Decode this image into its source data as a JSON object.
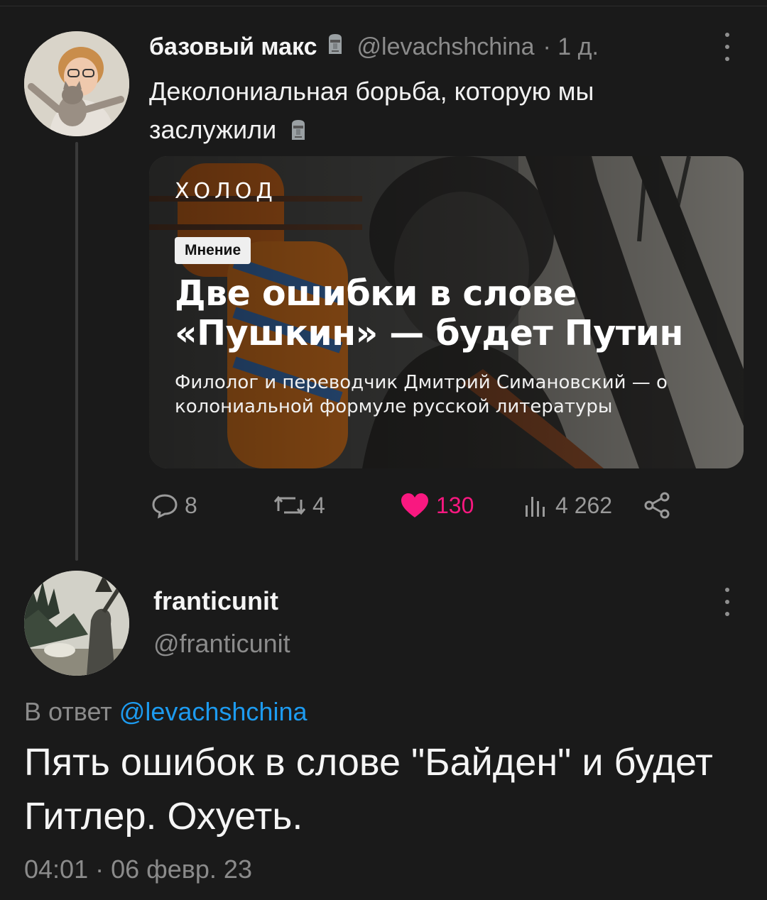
{
  "parent_tweet": {
    "author_name": "базовый макс",
    "name_emoji_icon": "moai-icon",
    "handle": "@levachshchina",
    "time": "· 1 д.",
    "text": "Деколониальная борьба, которую мы заслужили",
    "card": {
      "brand": "ХОЛОД",
      "tag": "Мнение",
      "headline": "Две ошибки в слове «Пушкин» — будет Путин",
      "subline": "Филолог и переводчик Дмитрий Симановский — о колониальной формуле русской литературы"
    },
    "actions": {
      "replies": "8",
      "retweets": "4",
      "likes": "130",
      "views": "4 262",
      "like_color": "#f91880"
    }
  },
  "reply_tweet": {
    "author_name": "franticunit",
    "handle": "@franticunit",
    "reply_to_prefix": "В ответ",
    "reply_to_handle": "@levachshchina",
    "text": "Пять ошибок в слове \"Байден\" и будет Гитлер. Охуеть.",
    "timestamp": "04:01 · 06 февр. 23"
  },
  "colors": {
    "background": "#1a1a1a",
    "muted": "#8b8b8b",
    "link": "#1d9bf0"
  }
}
